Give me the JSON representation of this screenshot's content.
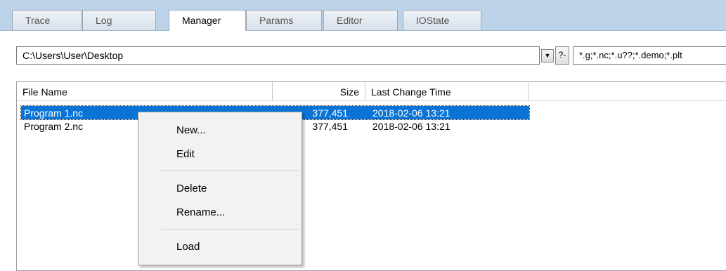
{
  "tabs": [
    {
      "label": "Trace"
    },
    {
      "label": "Log"
    },
    {
      "label": "Manager"
    },
    {
      "label": "Params"
    },
    {
      "label": "Editor"
    },
    {
      "label": "IOState"
    }
  ],
  "path": {
    "value": "C:\\Users\\User\\Desktop"
  },
  "help_button": {
    "label": "?-"
  },
  "filter": {
    "value": "*.g;*.nc;*.u??;*.demo;*.plt"
  },
  "columns": {
    "name": "File Name",
    "size": "Size",
    "time": "Last Change Time"
  },
  "files": [
    {
      "name": "Program 1.nc",
      "size": "377,451",
      "time": "2018-02-06  13:21",
      "selected": true
    },
    {
      "name": "Program 2.nc",
      "size": "377,451",
      "time": "2018-02-06  13:21",
      "selected": false
    }
  ],
  "context_menu": {
    "new": "New...",
    "edit": "Edit",
    "delete": "Delete",
    "rename": "Rename...",
    "load": "Load"
  },
  "icons": {
    "combo_arrow": "▼"
  }
}
